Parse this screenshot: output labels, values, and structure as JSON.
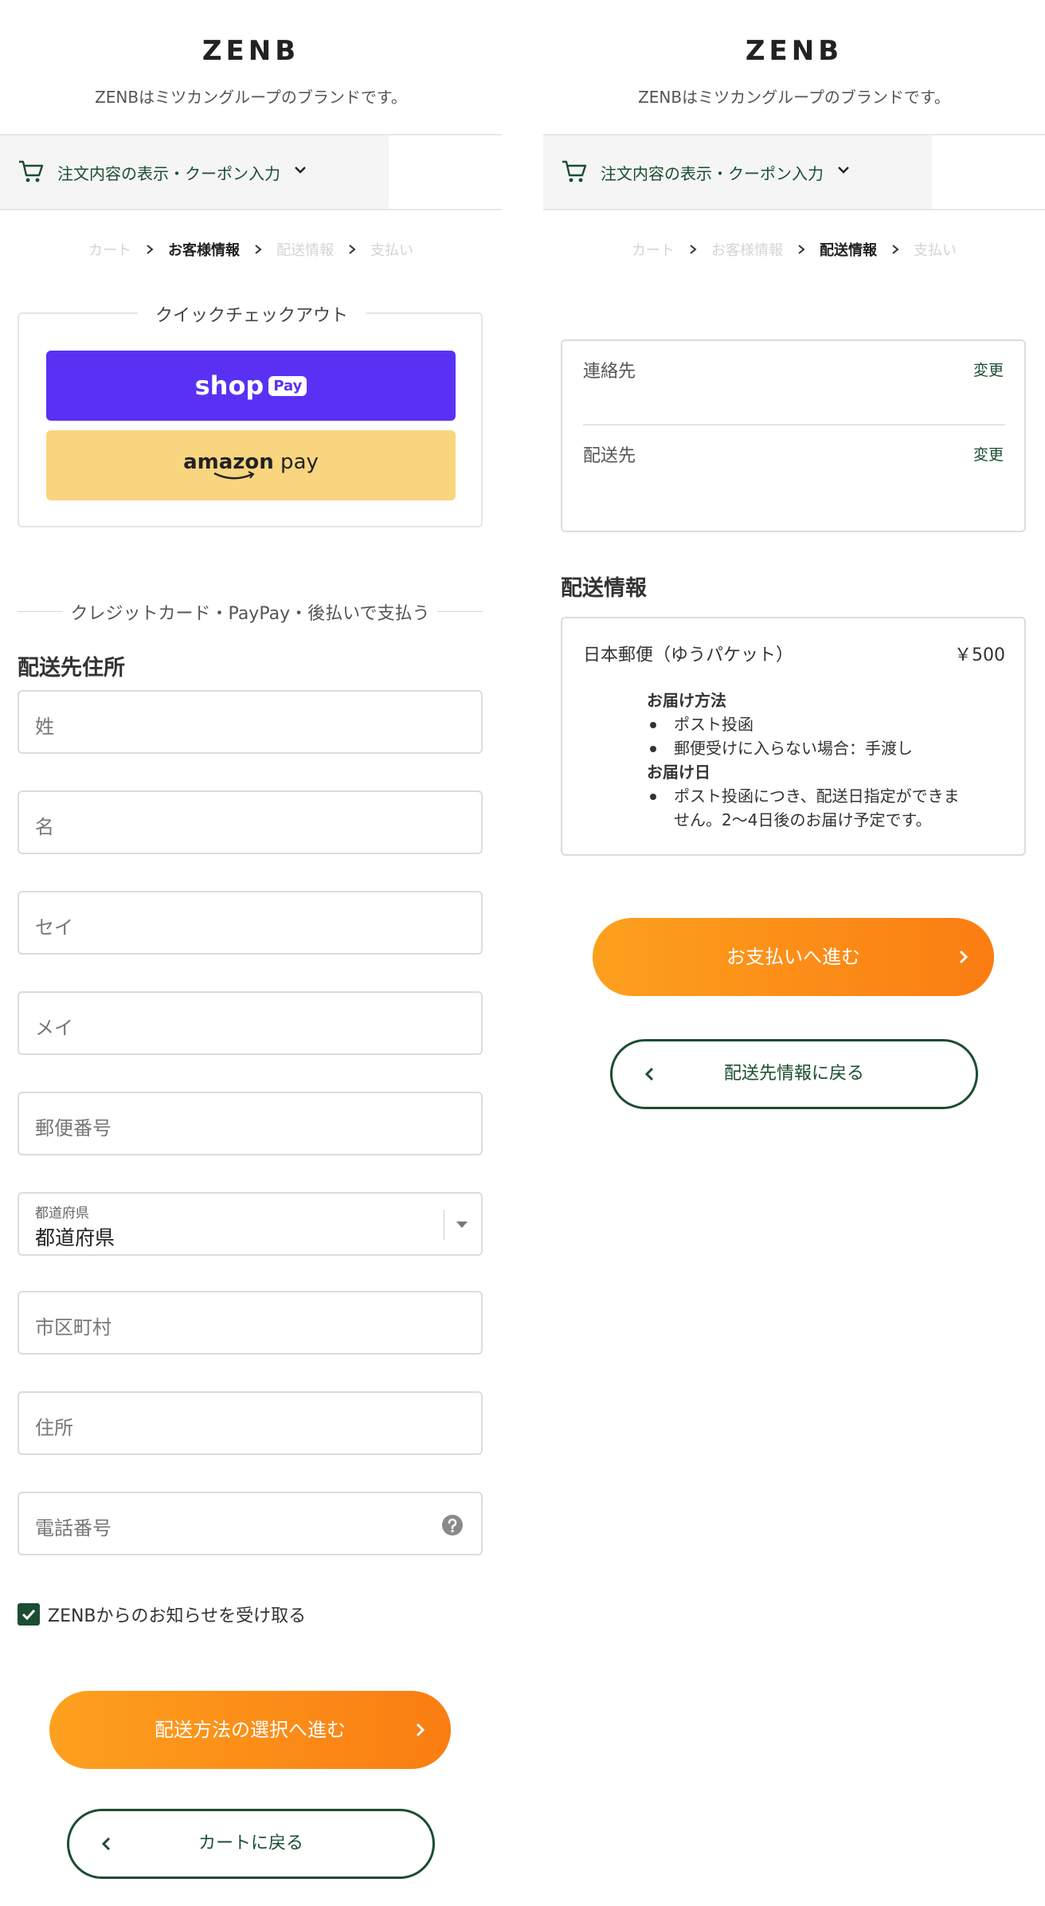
{
  "brand": {
    "logo": "ZENB",
    "tagline": "ZENBはミツカングループのブランドです。"
  },
  "order_summary": {
    "label": "注文内容の表示・クーポン入力"
  },
  "breadcrumb": {
    "cart": "カート",
    "customer": "お客様情報",
    "shipping": "配送情報",
    "payment": "支払い"
  },
  "left": {
    "quick_checkout": {
      "title": "クイックチェックアウト",
      "shop_pay": {
        "word": "shop",
        "pill": "Pay"
      },
      "amazon_pay": {
        "bold": "amazon",
        "rest": " pay"
      }
    },
    "alt_payment_title": "クレジットカード・PayPay・後払いで支払う",
    "shipping_address_heading": "配送先住所",
    "fields": {
      "last_name": "姓",
      "first_name": "名",
      "last_name_kana": "セイ",
      "first_name_kana": "メイ",
      "postal_code": "郵便番号",
      "prefecture_label": "都道府県",
      "prefecture_value": "都道府県",
      "city": "市区町村",
      "address": "住所",
      "phone": "電話番号"
    },
    "newsletter": {
      "label": "ZENBからのお知らせを受け取る",
      "checked": true
    },
    "continue_button": "配送方法の選択へ進む",
    "back_button": "カートに戻る"
  },
  "right": {
    "contact_label": "連絡先",
    "ship_to_label": "配送先",
    "change_link": "変更",
    "shipping_info_heading": "配送情報",
    "shipping_method": {
      "name": "日本郵便（ゆうパケット）",
      "price": "￥500",
      "delivery_method_heading": "お届け方法",
      "delivery_method_items": [
        "ポスト投函",
        "郵便受けに入らない場合：手渡し"
      ],
      "delivery_date_heading": "お届け日",
      "delivery_date_item_line1": "ポスト投函につき、配送日指定ができま",
      "delivery_date_item_line2": "せん。2〜4日後のお届け予定です。"
    },
    "continue_button": "お支払いへ進む",
    "back_button": "配送先情報に戻る"
  },
  "colors": {
    "brand_green": "#1b4d32",
    "shop_pay_purple": "#5a31f4",
    "amazon_yellow": "#f8d57e",
    "orange_start": "#fda01e",
    "orange_end": "#fa7d12"
  }
}
